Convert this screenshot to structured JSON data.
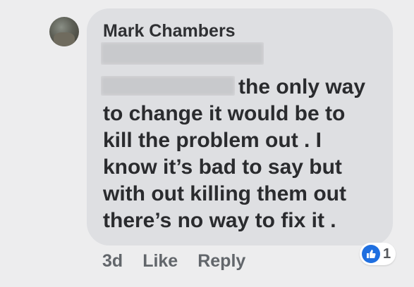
{
  "comment": {
    "author": "Mark Chambers",
    "lines": [
      "the only way",
      "to change it would be to",
      "kill the problem out . I",
      "know it’s bad to say but",
      "with out killing them out",
      "there’s no way to fix it ."
    ],
    "timestamp": "3d",
    "like_label": "Like",
    "reply_label": "Reply",
    "reaction_count": "1",
    "reaction_icon": "thumbs-up-icon"
  },
  "colors": {
    "background": "#ededee",
    "bubble": "#dedfe2",
    "like_badge": "#1f6fe0"
  }
}
